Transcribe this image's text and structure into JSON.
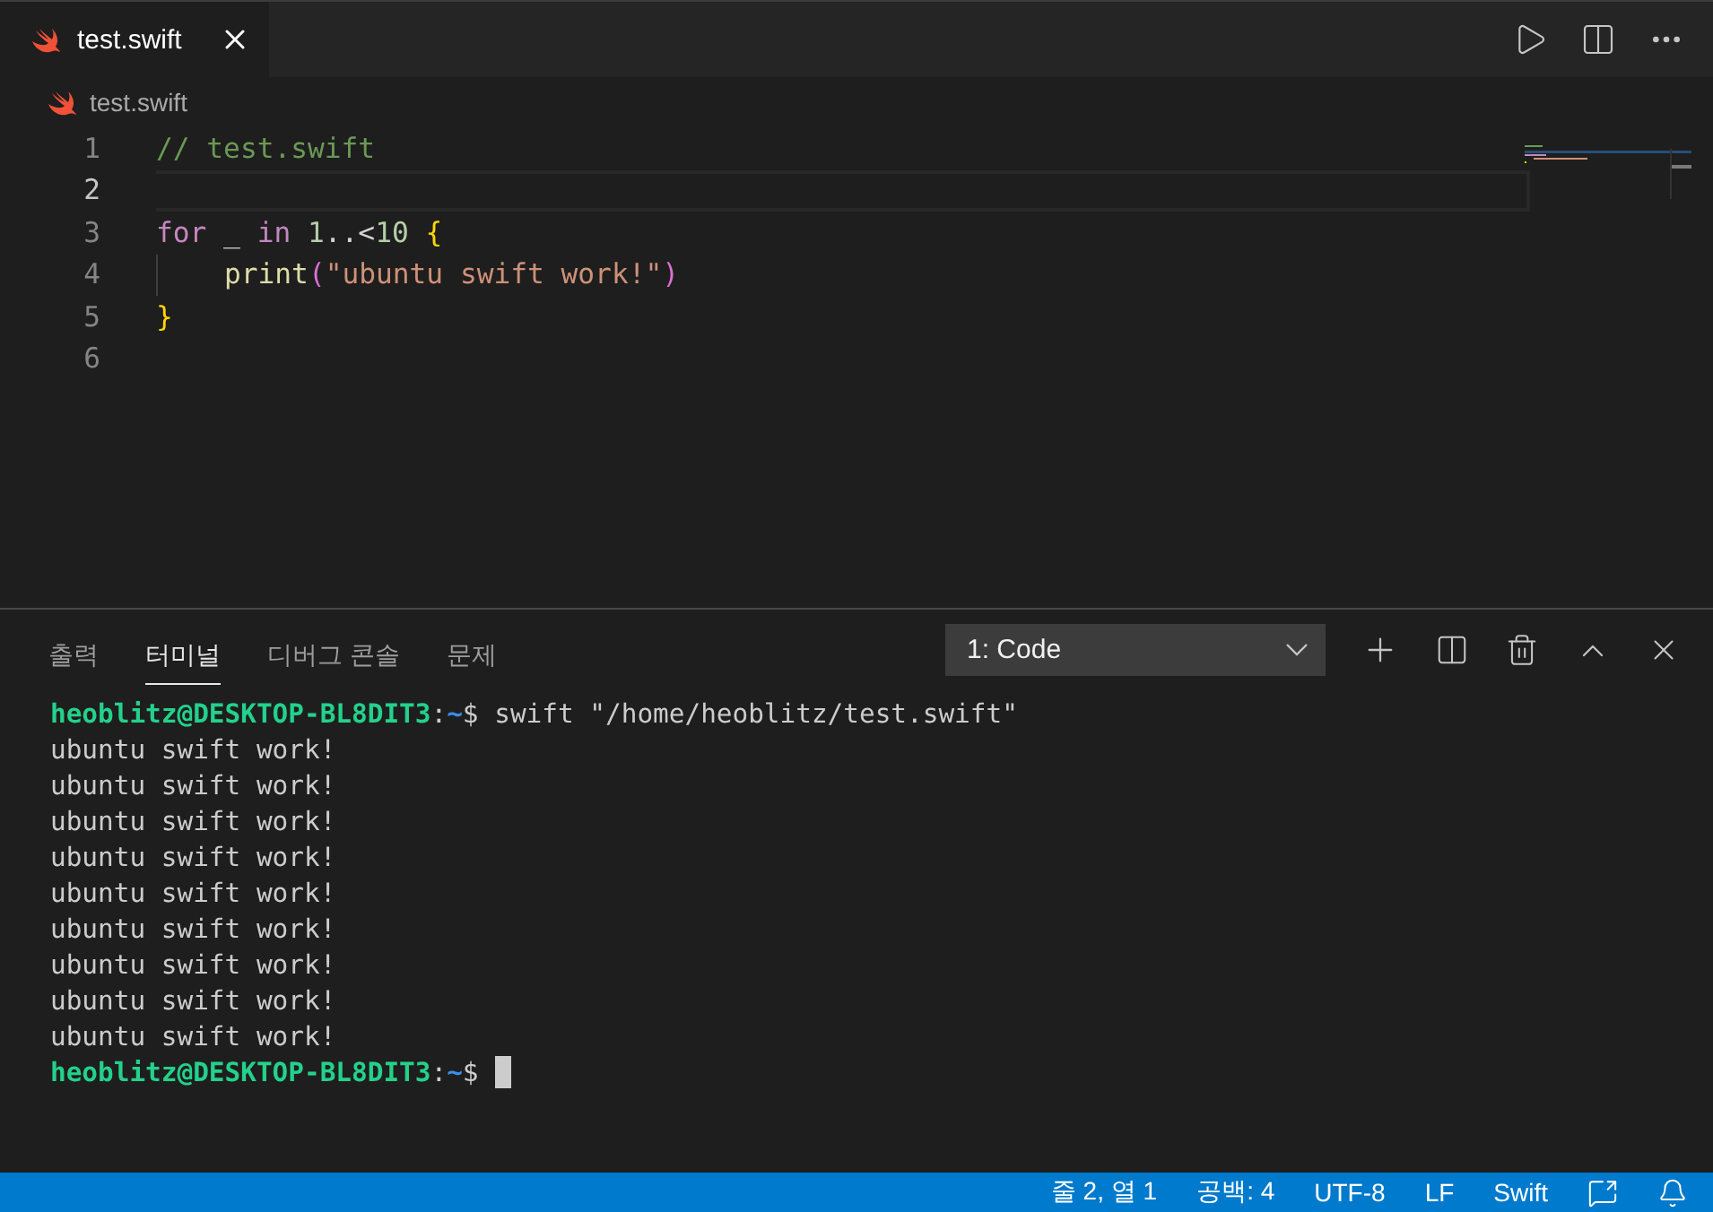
{
  "editor_tabs": [
    {
      "label": "test.swift",
      "selected": true
    }
  ],
  "breadcrumb": "test.swift",
  "code_lines": [
    {
      "number": "1",
      "current": false,
      "tokens": [
        {
          "kind": "comment",
          "text": "// test.swift"
        }
      ]
    },
    {
      "number": "2",
      "current": true
    },
    {
      "number": "3",
      "current": false,
      "tokens": [
        {
          "kind": "keyword",
          "text": "for"
        },
        {
          "kind": "plain",
          "text": " _ "
        },
        {
          "kind": "keyword",
          "text": "in "
        },
        {
          "kind": "number",
          "text": "1"
        },
        {
          "kind": "plain",
          "text": "..<"
        },
        {
          "kind": "number",
          "text": "10 "
        },
        {
          "kind": "bracket",
          "text": "{"
        }
      ]
    },
    {
      "number": "4",
      "current": false,
      "indent": true,
      "tokens": [
        {
          "kind": "function",
          "text": "print"
        },
        {
          "kind": "bracket2",
          "text": "("
        },
        {
          "kind": "string",
          "text": "\"ubuntu swift work!\""
        },
        {
          "kind": "bracket2",
          "text": ")"
        }
      ]
    },
    {
      "number": "5",
      "current": false,
      "tokens": [
        {
          "kind": "bracket",
          "text": "}"
        }
      ]
    },
    {
      "number": "6",
      "current": false
    }
  ],
  "panel_tabs": [
    {
      "label": "출력",
      "selected": false
    },
    {
      "label": "터미널",
      "selected": true
    },
    {
      "label": "디버그 콘솔",
      "selected": false
    },
    {
      "label": "문제",
      "selected": false
    }
  ],
  "terminal_select": {
    "value": "1: Code"
  },
  "terminal_lines": [
    {
      "kind": "prompt",
      "user_host": "heoblitz@DESKTOP-BL8DIT3",
      "separator": ":",
      "path": "~",
      "symbol": "$",
      "command": "swift \"/home/heoblitz/test.swift\"",
      "cursor": false
    },
    {
      "kind": "output",
      "text": "ubuntu swift work!"
    },
    {
      "kind": "output",
      "text": "ubuntu swift work!"
    },
    {
      "kind": "output",
      "text": "ubuntu swift work!"
    },
    {
      "kind": "output",
      "text": "ubuntu swift work!"
    },
    {
      "kind": "output",
      "text": "ubuntu swift work!"
    },
    {
      "kind": "output",
      "text": "ubuntu swift work!"
    },
    {
      "kind": "output",
      "text": "ubuntu swift work!"
    },
    {
      "kind": "output",
      "text": "ubuntu swift work!"
    },
    {
      "kind": "output",
      "text": "ubuntu swift work!"
    },
    {
      "kind": "prompt",
      "user_host": "heoblitz@DESKTOP-BL8DIT3",
      "separator": ":",
      "path": "~",
      "symbol": "$",
      "cursor": true
    }
  ],
  "status_bar": {
    "items": [
      "줄 2, 열 1",
      "공백: 4",
      "UTF-8",
      "LF",
      "Swift"
    ]
  }
}
